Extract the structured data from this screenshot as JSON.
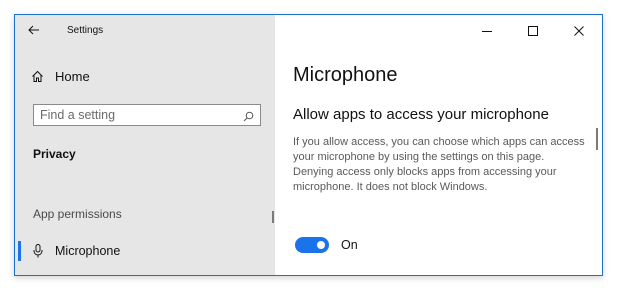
{
  "titlebar": {
    "title": "Settings",
    "back_icon": "arrow-left-icon",
    "minimize_icon": "minimize-icon",
    "maximize_icon": "maximize-icon",
    "close_icon": "close-icon"
  },
  "sidebar": {
    "home": {
      "label": "Home",
      "icon": "home-icon"
    },
    "search": {
      "placeholder": "Find a setting",
      "value": "",
      "icon": "search-icon"
    },
    "section_label": "Privacy",
    "subsection_label": "App permissions",
    "items": [
      {
        "label": "Microphone",
        "icon": "microphone-icon",
        "selected": true
      }
    ]
  },
  "main": {
    "page_title": "Microphone",
    "subheading": "Allow apps to access your microphone",
    "description": "If you allow access, you can choose which apps can access your microphone by using the settings on this page. Denying access only blocks apps from accessing your microphone. It does not block Windows.",
    "toggle": {
      "state": "on",
      "label": "On"
    }
  },
  "colors": {
    "accent": "#1a73e8",
    "sidebar_bg": "#e6e6e6",
    "window_border": "#1a73c9"
  }
}
